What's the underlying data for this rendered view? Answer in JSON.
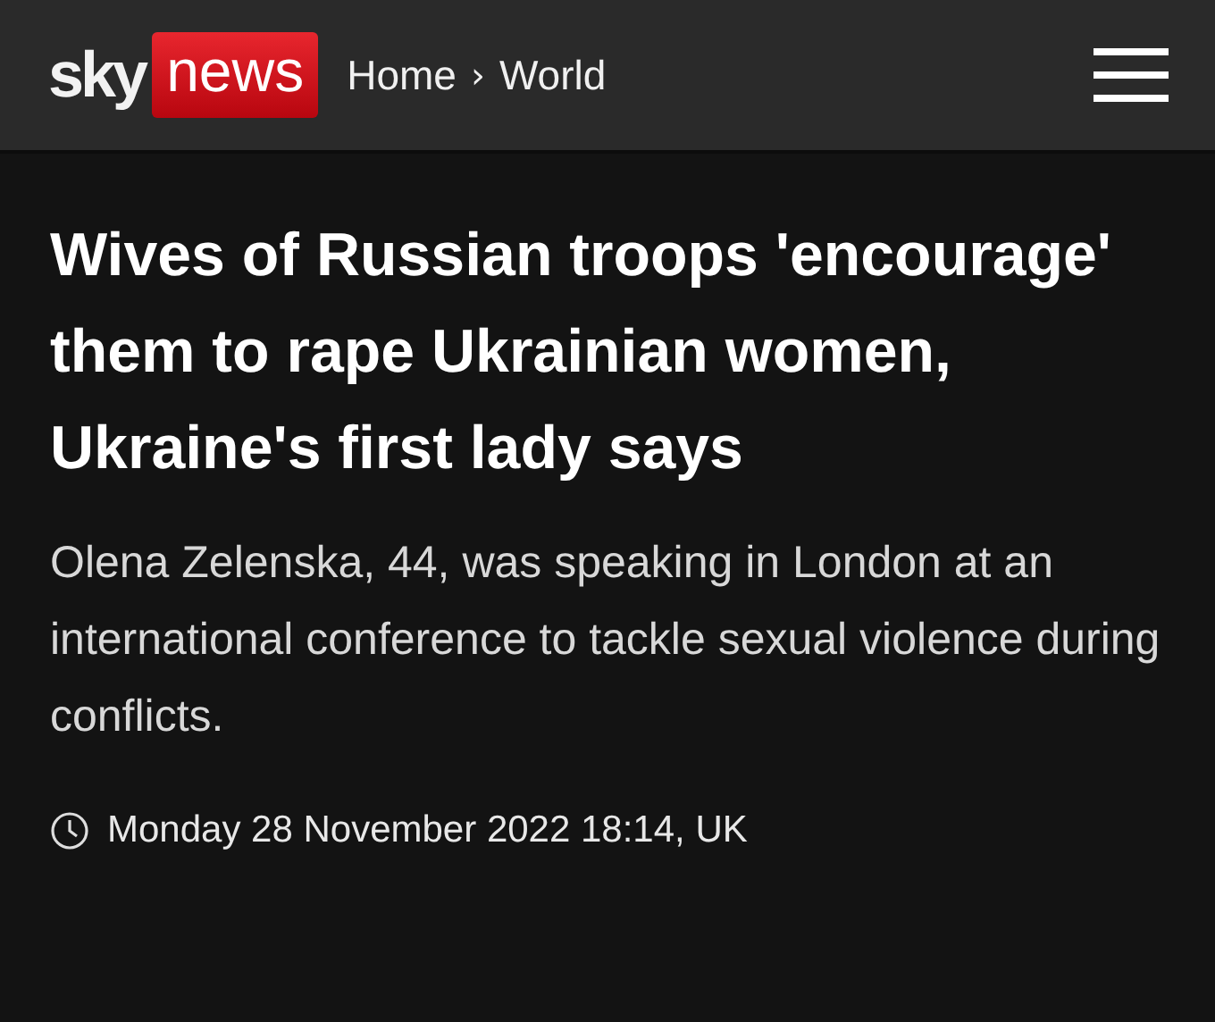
{
  "header": {
    "logo": {
      "sky": "sky",
      "news": "news"
    },
    "breadcrumb": [
      {
        "label": "Home"
      },
      {
        "label": "World"
      }
    ],
    "separator": "›"
  },
  "article": {
    "headline": "Wives of Russian troops 'encourage' them to rape Ukrainian women, Ukraine's first lady says",
    "summary": "Olena Zelenska, 44, was speaking in London at an international conference to tackle sexual violence during conflicts.",
    "timestamp": "Monday 28 November 2022 18:14, UK"
  }
}
